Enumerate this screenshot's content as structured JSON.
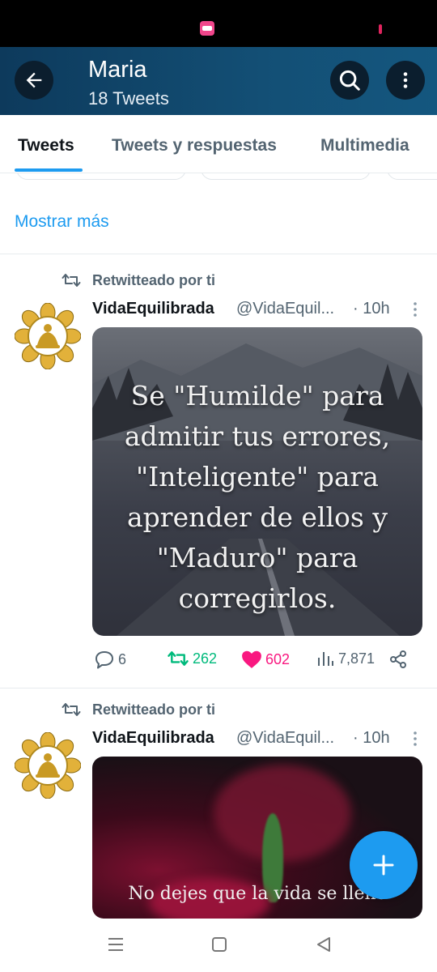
{
  "header": {
    "title": "Maria",
    "subtitle": "18 Tweets"
  },
  "tabs": [
    {
      "label": "Tweets",
      "active": true
    },
    {
      "label": "Tweets y respuestas",
      "active": false
    },
    {
      "label": "Multimedia",
      "active": false
    }
  ],
  "show_more": "Mostrar más",
  "tweets": [
    {
      "retweet_label": "Retwitteado por ti",
      "author_name": "VidaEquilibrada",
      "author_handle": "@VidaEquil...",
      "time": "· 10h",
      "media_quote": [
        "Se \"Humilde\" para",
        "admitir tus errores,",
        "\"Inteligente\" para",
        "aprender de ellos y",
        "\"Maduro\" para",
        "corregirlos."
      ],
      "replies": "6",
      "retweets": "262",
      "likes": "602",
      "views": "7,871"
    },
    {
      "retweet_label": "Retwitteado por ti",
      "author_name": "VidaEquilibrada",
      "author_handle": "@VidaEquil...",
      "time": "· 10h",
      "media_quote": "No dejes que la vida se llene"
    }
  ],
  "colors": {
    "accent": "#1d9bf0",
    "retweet": "#00ba7c",
    "like": "#f91880",
    "header": "#134f75"
  }
}
